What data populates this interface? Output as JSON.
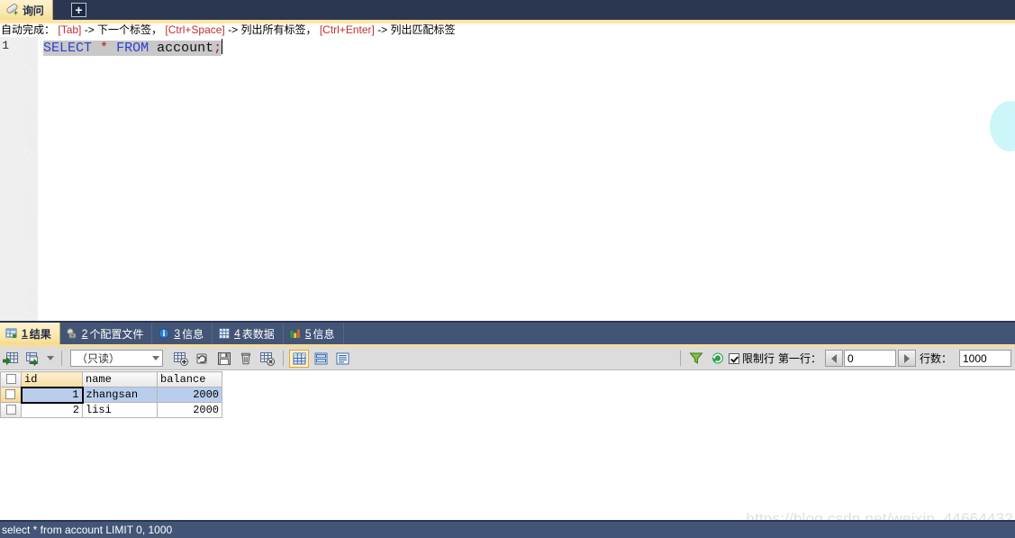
{
  "window": {
    "tab": {
      "label": "询问",
      "icon": "query-pill-icon"
    },
    "new_tab_label": "+"
  },
  "hint": {
    "prefix": "自动完成：",
    "items": [
      {
        "key": "[Tab]",
        "text": "-> 下一个标签，"
      },
      {
        "key": "[Ctrl+Space]",
        "text": "-> 列出所有标签，"
      },
      {
        "key": "[Ctrl+Enter]",
        "text": "-> 列出匹配标签"
      }
    ]
  },
  "editor": {
    "line_number": "1",
    "tokens": {
      "select": "SELECT",
      "star": "*",
      "from": "FROM",
      "table": "account",
      "semicolon": ";"
    },
    "full_text": "SELECT * FROM account;"
  },
  "result_tabs": [
    {
      "num": "1",
      "label": "结果",
      "icon": "result-grid-icon",
      "active": true
    },
    {
      "num": "2",
      "label": "个配置文件",
      "icon": "profile-icon",
      "active": false
    },
    {
      "num": "3",
      "label": "信息",
      "icon": "info-icon",
      "active": false
    },
    {
      "num": "4",
      "label": "表数据",
      "icon": "table-data-icon",
      "active": false
    },
    {
      "num": "5",
      "label": "信息",
      "icon": "chart-info-icon",
      "active": false
    }
  ],
  "grid_toolbar": {
    "buttons": [
      {
        "name": "apply-changes-icon"
      },
      {
        "name": "export-grid-icon"
      },
      {
        "name": "dropdown-arrow-icon"
      }
    ],
    "mode_select": {
      "value": "（只读）"
    },
    "actions": [
      {
        "name": "add-record-icon"
      },
      {
        "name": "refresh-record-icon"
      },
      {
        "name": "save-record-icon"
      },
      {
        "name": "delete-record-icon"
      },
      {
        "name": "cancel-record-icon"
      }
    ],
    "views": [
      {
        "name": "grid-view-icon",
        "active": true
      },
      {
        "name": "form-view-icon",
        "active": false
      },
      {
        "name": "text-view-icon",
        "active": false
      }
    ],
    "filter_icon": "filter-icon",
    "refresh_icon": "refresh-icon",
    "limit_checkbox": {
      "label": "限制行",
      "checked": true
    },
    "first_row": {
      "label": "第一行：",
      "value": "0"
    },
    "row_count": {
      "label": "行数：",
      "value": "1000"
    }
  },
  "grid": {
    "columns": [
      "id",
      "name",
      "balance"
    ],
    "rows": [
      {
        "id": "1",
        "name": "zhangsan",
        "balance": "2000",
        "selected": true
      },
      {
        "id": "2",
        "name": "lisi",
        "balance": "2000",
        "selected": false
      }
    ]
  },
  "status": {
    "query": "select * from account LIMIT 0, 1000"
  },
  "watermark": "https://blog.csdn.net/weixin_44664432"
}
